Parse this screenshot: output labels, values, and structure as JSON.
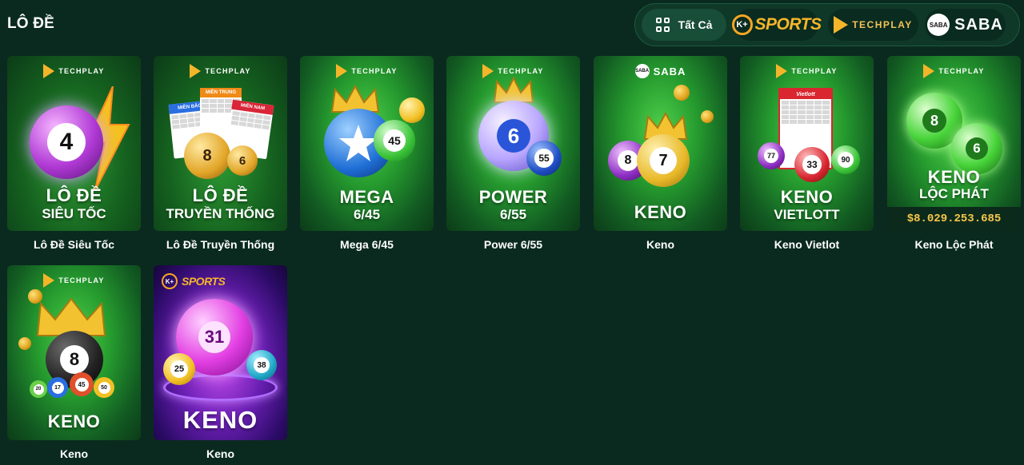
{
  "header": {
    "title": "LÔ ĐỀ",
    "filters": {
      "all_label": "Tất Cả",
      "sports_badge": "K+",
      "sports_label": "SPORTS",
      "techplay_label": "TECHPLAY",
      "saba_badge": "SABA",
      "saba_label": "SABA"
    }
  },
  "games": [
    {
      "label": "Lô Đề Siêu Tốc",
      "provider": "TECHPLAY",
      "line1": "LÔ ĐỀ",
      "line2": "SIÊU TỐC",
      "ball": "4"
    },
    {
      "label": "Lô Đề Truyền Thống",
      "provider": "TECHPLAY",
      "line1": "LÔ ĐỀ",
      "line2": "TRUYỀN THỐNG",
      "ticket1": "MIỀN BẮC",
      "ticket2": "MIỀN TRUNG",
      "ticket3": "MIỀN NAM",
      "ball1": "8",
      "ball2": "6"
    },
    {
      "label": "Mega 6/45",
      "provider": "TECHPLAY",
      "line1": "MEGA",
      "line2": "6/45",
      "ball": "45"
    },
    {
      "label": "Power 6/55",
      "provider": "TECHPLAY",
      "line1": "POWER",
      "line2": "6/55",
      "ball1": "6",
      "ball2": "55"
    },
    {
      "label": "Keno",
      "provider": "SABA",
      "provider_badge": "SABA",
      "line1": "KENO",
      "ball1": "8",
      "ball2": "7"
    },
    {
      "label": "Keno Vietlot",
      "provider": "TECHPLAY",
      "line1": "KENO",
      "line2": "VIETLOTT",
      "ticket": "Vietlott",
      "ball1": "77",
      "ball2": "33",
      "ball3": "90"
    },
    {
      "label": "Keno Lộc Phát",
      "provider": "TECHPLAY",
      "line1": "KENO",
      "line2": "LỘC PHÁT",
      "ball1": "8",
      "ball2": "6",
      "jackpot": "$8.029.253.685"
    },
    {
      "label": "Keno",
      "provider": "TECHPLAY",
      "line1": "KENO",
      "ball": "8",
      "small_balls": [
        "20",
        "17",
        "45",
        "50"
      ]
    },
    {
      "label": "Keno",
      "provider": "SPORTS",
      "provider_badge": "K+",
      "line1": "KENO",
      "ball1": "31",
      "ball2": "25",
      "ball3": "38"
    }
  ],
  "colors": {
    "background": "#0a2a1f",
    "accent_gold": "#f6b62a",
    "card_green": "#259a2e",
    "card_purple": "#6a1fb3"
  }
}
